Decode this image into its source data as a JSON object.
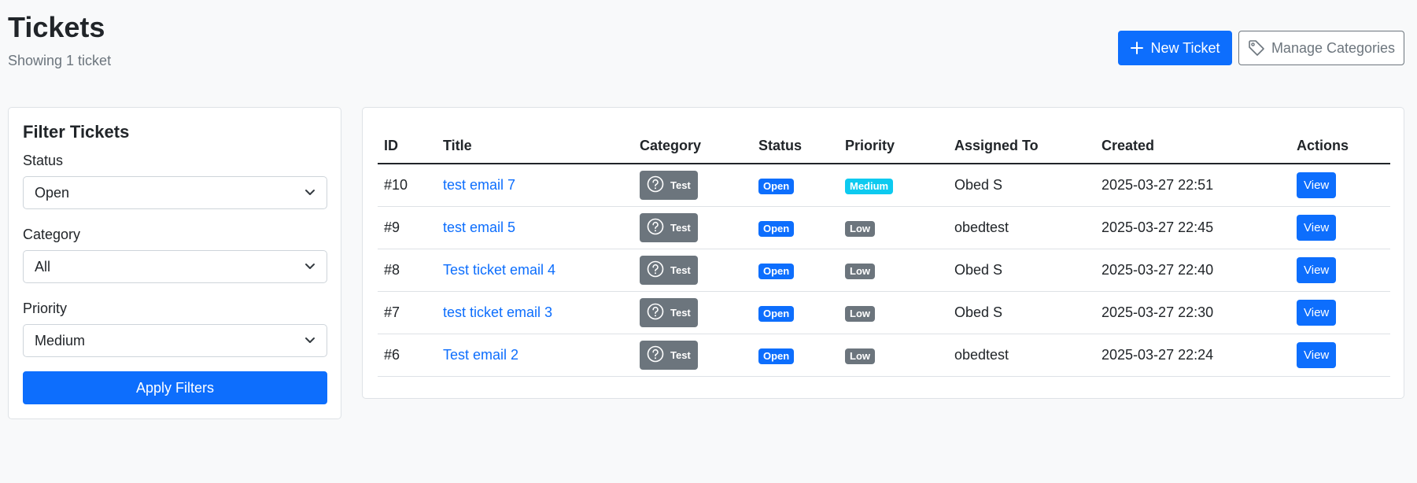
{
  "header": {
    "title": "Tickets",
    "subtitle": "Showing 1 ticket",
    "new_ticket_label": "New Ticket",
    "manage_categories_label": "Manage Categories"
  },
  "filters": {
    "title": "Filter Tickets",
    "status_label": "Status",
    "status_value": "Open",
    "category_label": "Category",
    "category_value": "All",
    "priority_label": "Priority",
    "priority_value": "Medium",
    "apply_label": "Apply Filters"
  },
  "table": {
    "columns": [
      "ID",
      "Title",
      "Category",
      "Status",
      "Priority",
      "Assigned To",
      "Created",
      "Actions"
    ],
    "rows": [
      {
        "id": "#10",
        "title": "test email 7",
        "category": "Test",
        "status": "Open",
        "priority": "Medium",
        "assigned": "Obed S",
        "created": "2025-03-27 22:51",
        "action": "View"
      },
      {
        "id": "#9",
        "title": "test email 5",
        "category": "Test",
        "status": "Open",
        "priority": "Low",
        "assigned": "obedtest",
        "created": "2025-03-27 22:45",
        "action": "View"
      },
      {
        "id": "#8",
        "title": "Test ticket email 4",
        "category": "Test",
        "status": "Open",
        "priority": "Low",
        "assigned": "Obed S",
        "created": "2025-03-27 22:40",
        "action": "View"
      },
      {
        "id": "#7",
        "title": "test ticket email 3",
        "category": "Test",
        "status": "Open",
        "priority": "Low",
        "assigned": "Obed S",
        "created": "2025-03-27 22:30",
        "action": "View"
      },
      {
        "id": "#6",
        "title": "Test email 2",
        "category": "Test",
        "status": "Open",
        "priority": "Low",
        "assigned": "obedtest",
        "created": "2025-03-27 22:24",
        "action": "View"
      }
    ]
  },
  "colors": {
    "primary": "#0d6efd",
    "info": "#0dcaf0",
    "secondary": "#6c757d"
  },
  "icons": {
    "new_ticket": "plus-icon",
    "manage_categories": "tag-icon",
    "category": "question-circle-icon",
    "select": "chevron-down-icon"
  }
}
